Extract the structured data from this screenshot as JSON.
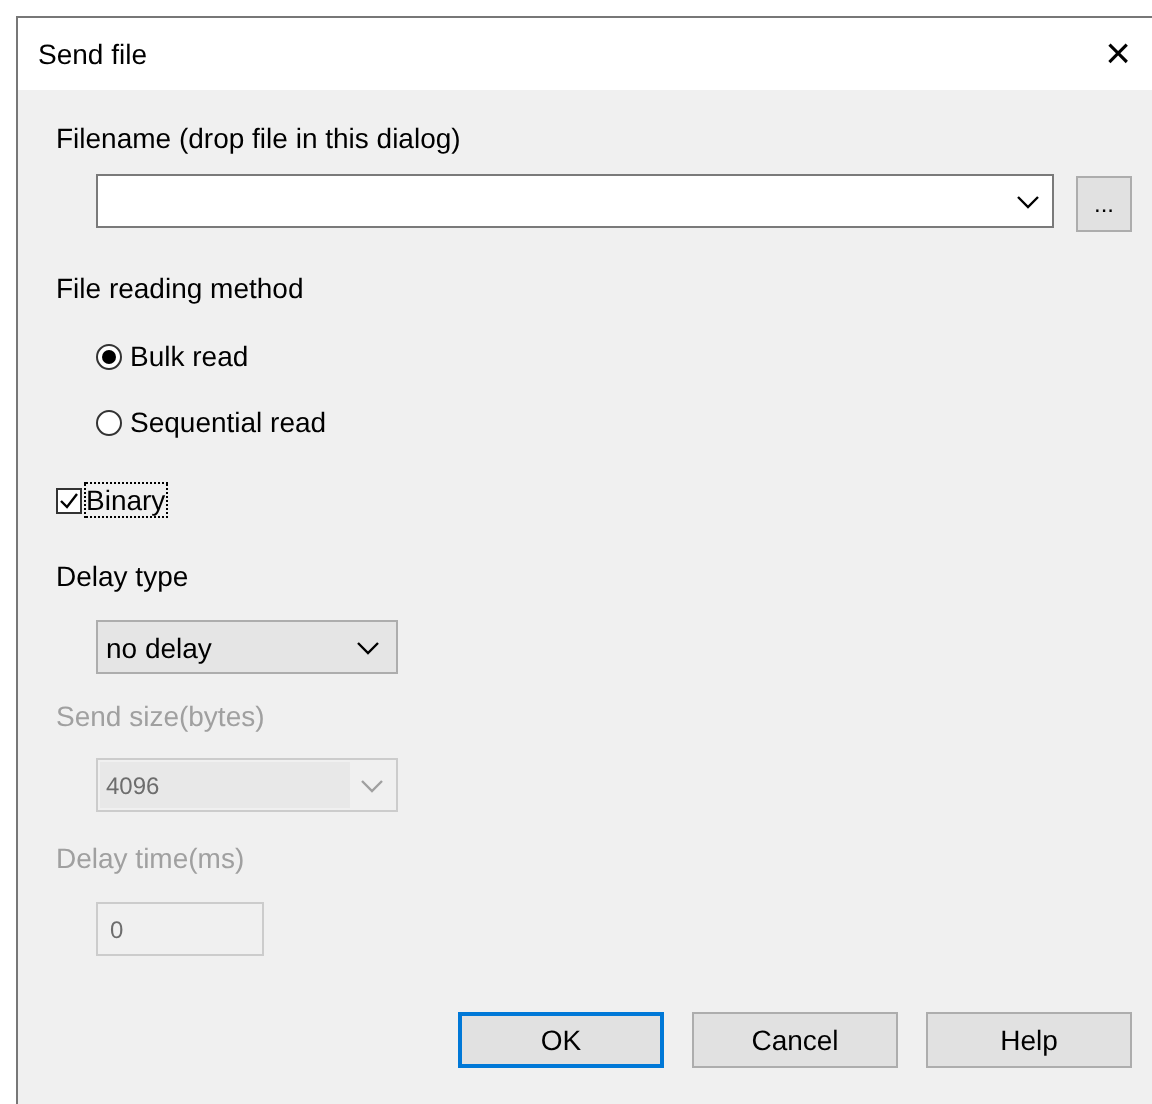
{
  "window": {
    "title": "Send file",
    "close": "×"
  },
  "filename": {
    "label": "Filename (drop file in this dialog)",
    "browse": "..."
  },
  "reading_method": {
    "label": "File reading method",
    "options": [
      {
        "label": "Bulk read",
        "selected": true
      },
      {
        "label": "Sequential read",
        "selected": false
      }
    ]
  },
  "binary": {
    "label": "Binary",
    "checked": true,
    "focused": true
  },
  "delay_type": {
    "label": "Delay type",
    "value": "no delay"
  },
  "send_size": {
    "label": "Send size(bytes)",
    "value": "4096",
    "disabled": true
  },
  "delay_time": {
    "label": "Delay time(ms)",
    "value": "0",
    "disabled": true
  },
  "buttons": [
    {
      "label": "OK",
      "default": true
    },
    {
      "label": "Cancel",
      "default": false
    },
    {
      "label": "Help",
      "default": false
    }
  ]
}
